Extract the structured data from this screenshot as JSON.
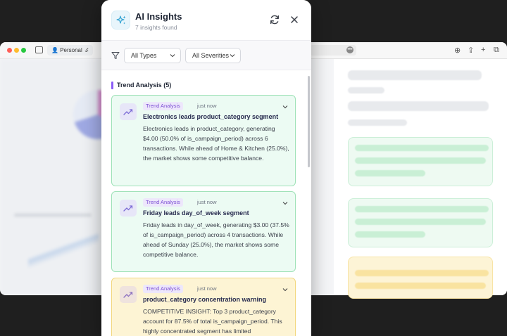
{
  "browser": {
    "profile_label": "Personal",
    "nav_back": "‹",
    "nav_forward": "›",
    "menu_dots": "•••"
  },
  "panel": {
    "title": "AI Insights",
    "subtitle": "7 insights found"
  },
  "filters": {
    "type_selected": "All Types",
    "severity_selected": "All Severities"
  },
  "section": {
    "title": "Trend Analysis (5)"
  },
  "insights": [
    {
      "badge": "Trend Analysis",
      "time": "just now",
      "title": "Electronics leads product_category segment",
      "body": "Electronics leads in product_category, generating $4.00 (50.0% of is_campaign_period) across 6 transactions. While ahead of Home & Kitchen (25.0%), the market shows some competitive balance."
    },
    {
      "badge": "Trend Analysis",
      "time": "just now",
      "title": "Friday leads day_of_week segment",
      "body": "Friday leads in day_of_week, generating $3.00 (37.5% of is_campaign_period) across 4 transactions. While ahead of Sunday (25.0%), the market shows some competitive balance."
    },
    {
      "badge": "Trend Analysis",
      "time": "just now",
      "title": "product_category concentration warning",
      "body": "COMPETITIVE INSIGHT: Top 3 product_category account for 87.5% of total is_campaign_period. This highly concentrated segment has limited"
    }
  ],
  "colors": {
    "accent_purple": "#8b5cf6",
    "card_green_bg": "#ecfbf3",
    "card_green_border": "#9fe2b8",
    "card_yellow_bg": "#fdf4d4",
    "card_yellow_border": "#f2d77e"
  },
  "icons": {
    "logo": "sparkles-icon",
    "refresh": "refresh-icon",
    "close": "close-icon",
    "filter": "filter-icon",
    "card": "trending-up-icon",
    "expand": "chevron-down-icon"
  }
}
